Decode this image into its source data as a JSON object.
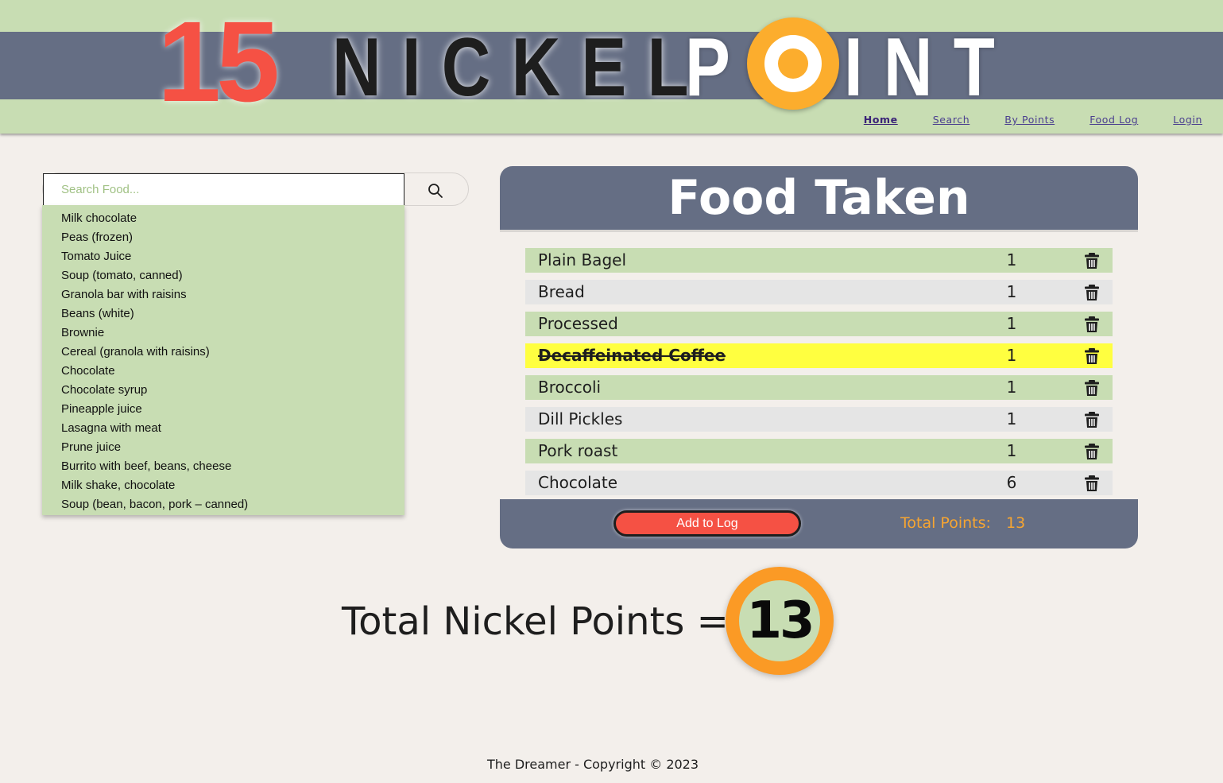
{
  "logo": {
    "number": "15",
    "word1": "NICKEL",
    "word2_first": "P",
    "word2_rest": "INT",
    "colors": {
      "number": "#f55144",
      "ring": "#fcad2d",
      "band": "#656e84",
      "header": "#c8ddb3"
    }
  },
  "nav": {
    "home": "Home",
    "search": "Search",
    "by_points": "By Points",
    "food_log": "Food Log",
    "login": "Login"
  },
  "search": {
    "placeholder": "Search Food...",
    "value": "",
    "icon": "search-icon",
    "suggestions": [
      "Milk chocolate",
      "Peas (frozen)",
      "Tomato Juice",
      "Soup (tomato, canned)",
      "Granola bar with raisins",
      "Beans (white)",
      "Brownie",
      "Cereal (granola with raisins)",
      "Chocolate",
      "Chocolate syrup",
      "Pineapple juice",
      "Lasagna with meat",
      "Prune juice",
      "Burrito with beef, beans, cheese",
      "Milk shake, chocolate",
      "Soup (bean, bacon, pork – canned)"
    ]
  },
  "food_taken": {
    "title": "Food Taken",
    "items": [
      {
        "name": "Plain Bagel",
        "qty": "1",
        "style": "green"
      },
      {
        "name": "Bread",
        "qty": "1",
        "style": "grey"
      },
      {
        "name": "Processed",
        "qty": "1",
        "style": "green"
      },
      {
        "name": "Decaffeinated Coffee",
        "qty": "1",
        "style": "marked"
      },
      {
        "name": "Broccoli",
        "qty": "1",
        "style": "green"
      },
      {
        "name": "Dill Pickles",
        "qty": "1",
        "style": "grey"
      },
      {
        "name": "Pork roast",
        "qty": "1",
        "style": "green"
      },
      {
        "name": "Chocolate",
        "qty": "6",
        "style": "grey"
      }
    ],
    "delete_icon": "trash-icon",
    "add_button": "Add to Log",
    "total_label": "Total Points:",
    "total_value": "13"
  },
  "grand_total": {
    "label": "Total Nickel Points =",
    "value": "13"
  },
  "footer": {
    "text": "The Dreamer - Copyright © 2023"
  }
}
